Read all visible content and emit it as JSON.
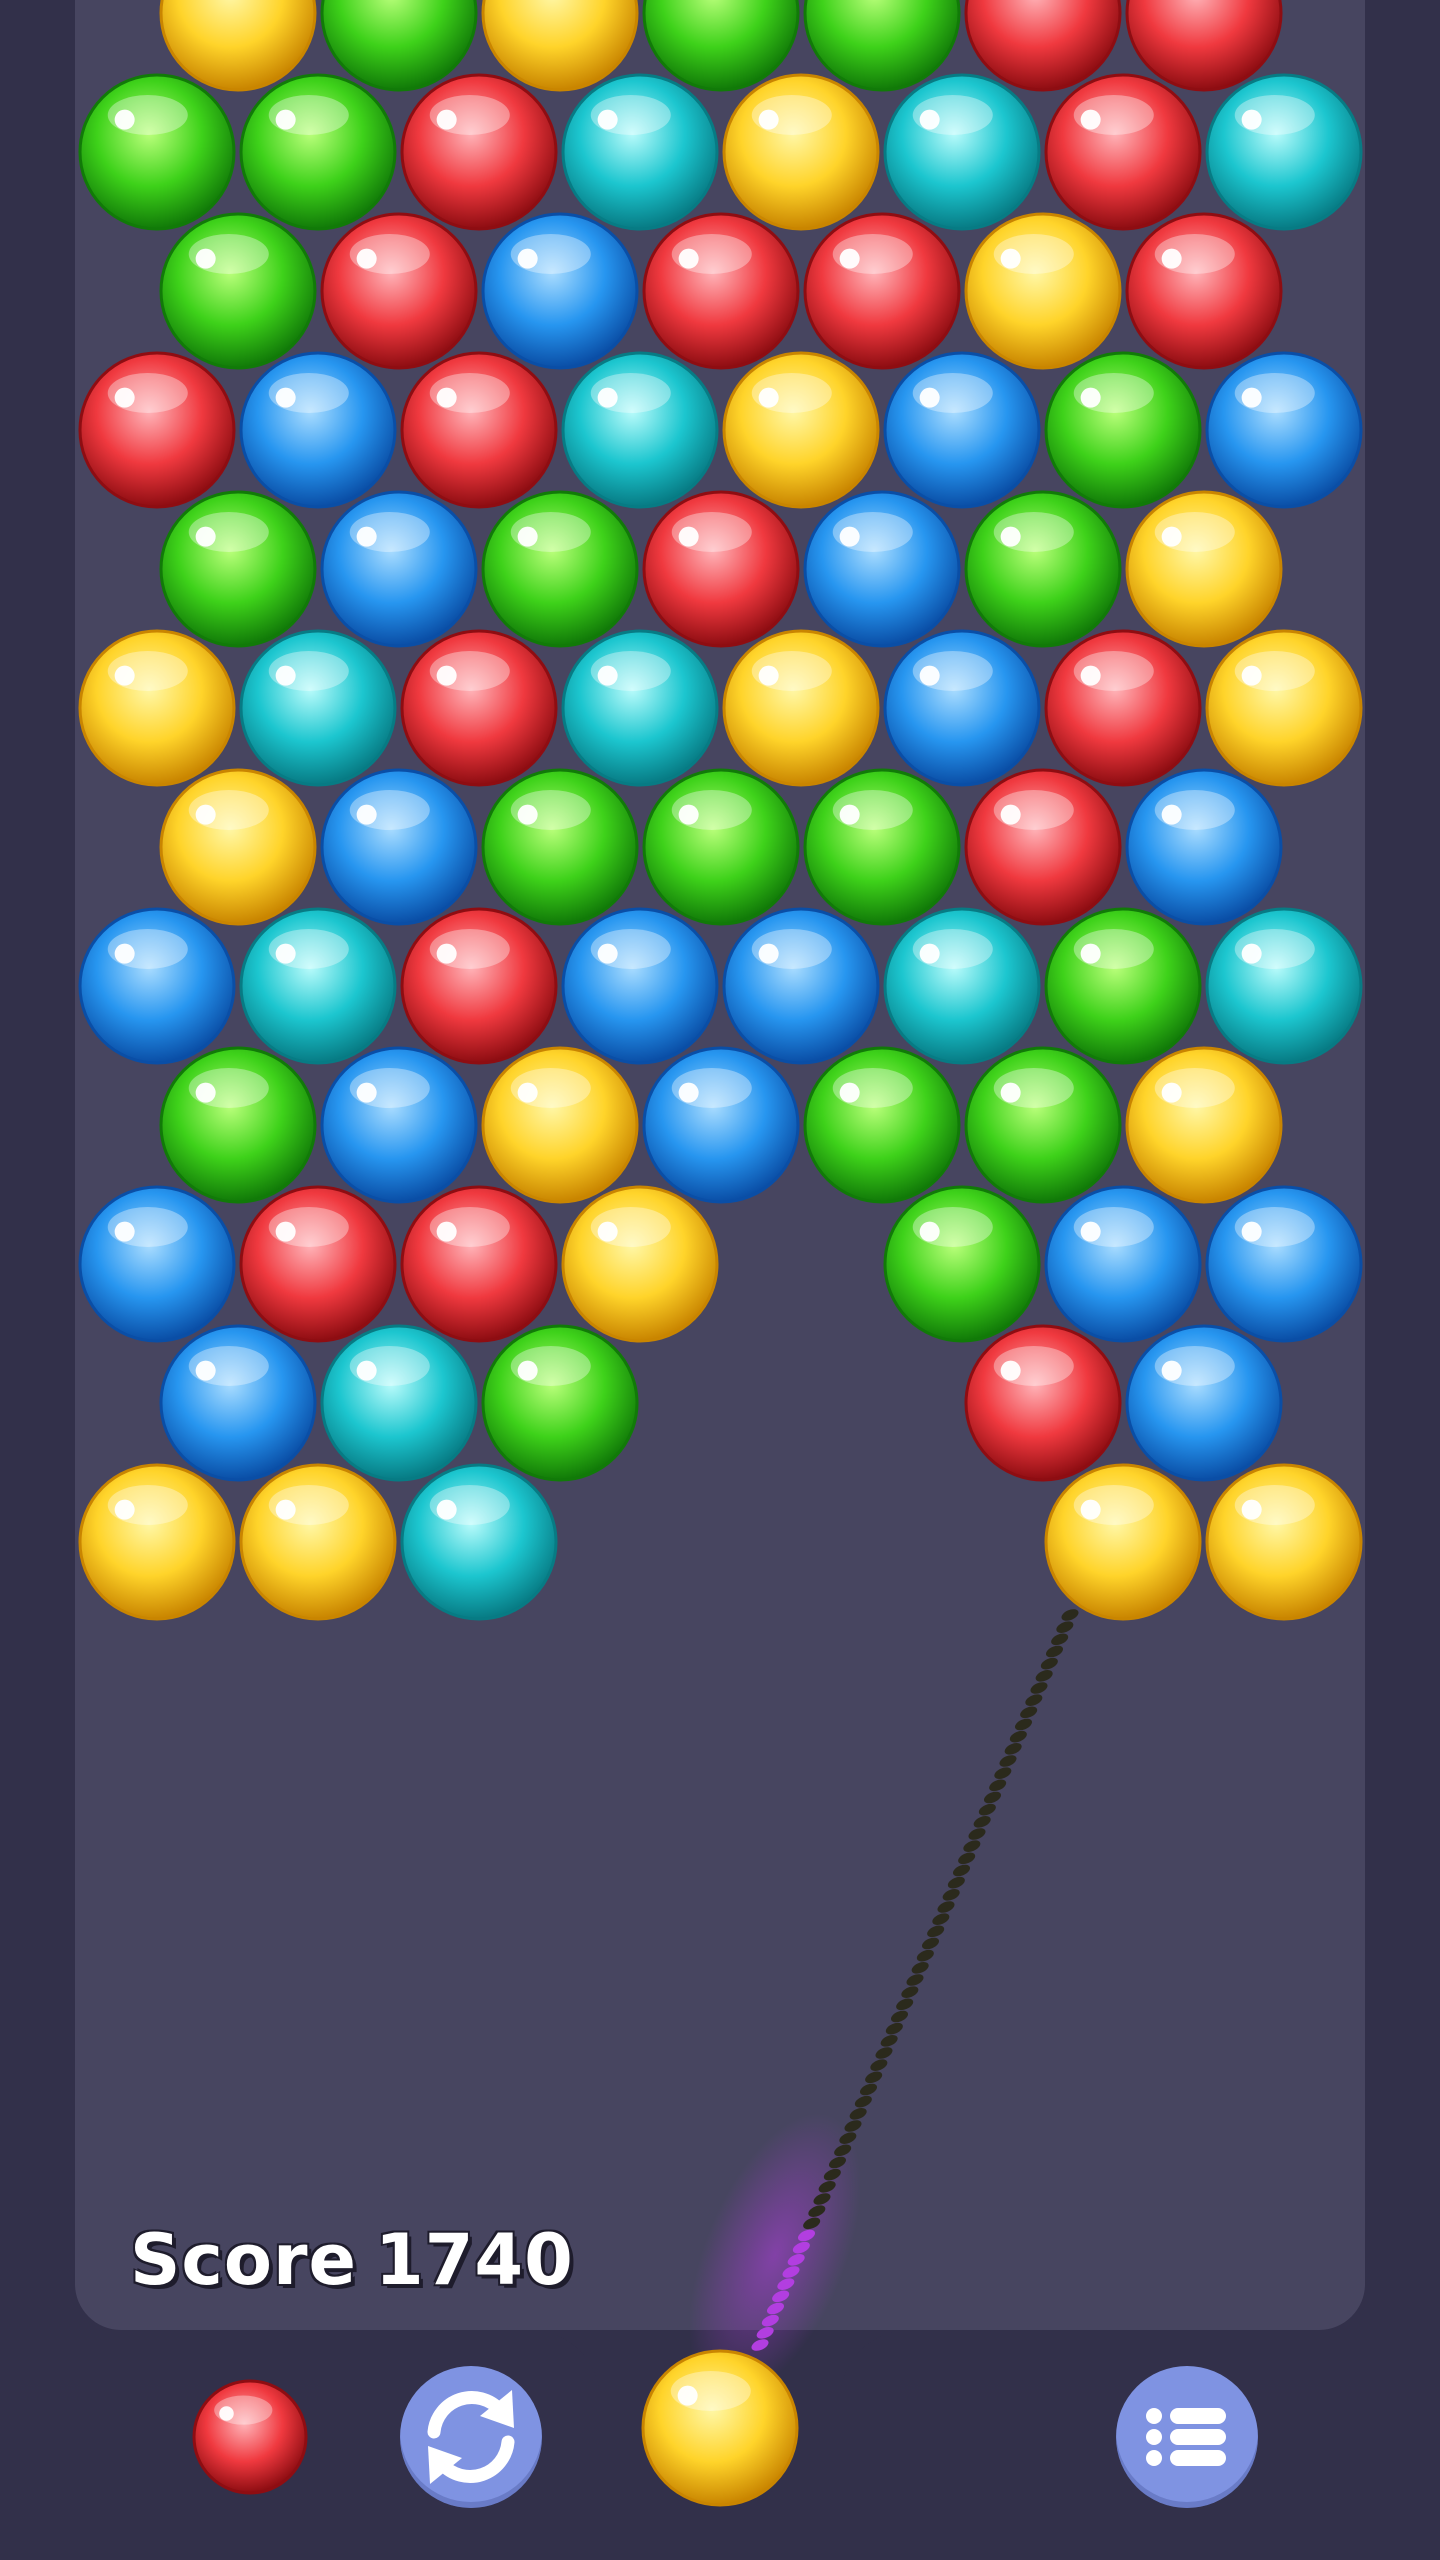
{
  "score": {
    "label": "Score",
    "value": "1740"
  },
  "colors": {
    "yellow": {
      "light": "#fff7a6",
      "mid": "#ffd42a",
      "dark": "#c98500"
    },
    "green": {
      "light": "#b9ff7a",
      "mid": "#3ed21a",
      "dark": "#117a08"
    },
    "red": {
      "light": "#ffb3b8",
      "mid": "#f0393f",
      "dark": "#8e0d12"
    },
    "cyan": {
      "light": "#b8fbfb",
      "mid": "#1cc6cf",
      "dark": "#077b84"
    },
    "blue": {
      "light": "#a9dcff",
      "mid": "#2796f0",
      "dark": "#0a4ea6"
    }
  },
  "grid_rows": [
    [
      "yellow",
      "green",
      "yellow",
      "green",
      "green",
      "red",
      "red"
    ],
    [
      "green",
      "green",
      "red",
      "cyan",
      "yellow",
      "cyan",
      "red",
      "cyan"
    ],
    [
      "green",
      "red",
      "blue",
      "red",
      "red",
      "yellow",
      "red"
    ],
    [
      "red",
      "blue",
      "red",
      "cyan",
      "yellow",
      "blue",
      "green",
      "blue"
    ],
    [
      "green",
      "blue",
      "green",
      "red",
      "blue",
      "green",
      "yellow"
    ],
    [
      "yellow",
      "cyan",
      "red",
      "cyan",
      "yellow",
      "blue",
      "red",
      "yellow"
    ],
    [
      "yellow",
      "blue",
      "green",
      "green",
      "green",
      "red",
      "blue"
    ],
    [
      "blue",
      "cyan",
      "red",
      "blue",
      "blue",
      "cyan",
      "green",
      "cyan"
    ],
    [
      "green",
      "blue",
      "yellow",
      "blue",
      "green",
      "green",
      "yellow"
    ],
    [
      "blue",
      "red",
      "red",
      "yellow",
      null,
      "green",
      "blue",
      "blue"
    ],
    [
      "blue",
      "cyan",
      "green",
      null,
      null,
      "red",
      "blue"
    ],
    [
      "yellow",
      "yellow",
      "cyan",
      null,
      null,
      null,
      "yellow",
      "yellow"
    ]
  ],
  "shooter_bubble": "yellow",
  "next_bubble": "red",
  "aim_line_color": "#2b2a1c",
  "aim_glow_color": "#b23ee0",
  "buttons": {
    "swap_icon": "swap-arrows-icon",
    "menu_icon": "menu-list-icon"
  }
}
